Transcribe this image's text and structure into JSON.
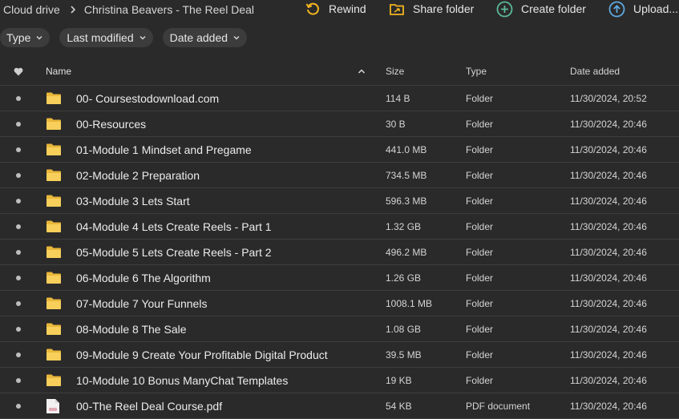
{
  "breadcrumb": [
    "Cloud drive",
    "Christina Beavers - The Reel Deal"
  ],
  "actions": {
    "rewind": "Rewind",
    "share_folder": "Share folder",
    "create_folder": "Create folder",
    "upload": "Upload..."
  },
  "filters": [
    "Type",
    "Last modified",
    "Date added"
  ],
  "columns": {
    "name": "Name",
    "size": "Size",
    "type": "Type",
    "date": "Date added"
  },
  "rows": [
    {
      "name": "00- Coursestodownload.com",
      "size": "114 B",
      "type": "Folder",
      "date": "11/30/2024, 20:52",
      "icon": "folder-icon"
    },
    {
      "name": "00-Resources",
      "size": "30 B",
      "type": "Folder",
      "date": "11/30/2024, 20:46",
      "icon": "folder-icon"
    },
    {
      "name": "01-Module 1 Mindset and Pregame",
      "size": "441.0 MB",
      "type": "Folder",
      "date": "11/30/2024, 20:46",
      "icon": "folder-icon"
    },
    {
      "name": "02-Module 2 Preparation",
      "size": "734.5 MB",
      "type": "Folder",
      "date": "11/30/2024, 20:46",
      "icon": "folder-icon"
    },
    {
      "name": "03-Module 3 Lets Start",
      "size": "596.3 MB",
      "type": "Folder",
      "date": "11/30/2024, 20:46",
      "icon": "folder-icon"
    },
    {
      "name": "04-Module 4 Lets Create Reels - Part 1",
      "size": "1.32 GB",
      "type": "Folder",
      "date": "11/30/2024, 20:46",
      "icon": "folder-icon"
    },
    {
      "name": "05-Module 5 Lets Create Reels - Part 2",
      "size": "496.2 MB",
      "type": "Folder",
      "date": "11/30/2024, 20:46",
      "icon": "folder-icon"
    },
    {
      "name": "06-Module 6 The Algorithm",
      "size": "1.26 GB",
      "type": "Folder",
      "date": "11/30/2024, 20:46",
      "icon": "folder-icon"
    },
    {
      "name": "07-Module 7 Your Funnels",
      "size": "1008.1 MB",
      "type": "Folder",
      "date": "11/30/2024, 20:46",
      "icon": "folder-icon"
    },
    {
      "name": "08-Module 8 The Sale",
      "size": "1.08 GB",
      "type": "Folder",
      "date": "11/30/2024, 20:46",
      "icon": "folder-icon"
    },
    {
      "name": "09-Module 9 Create Your Profitable Digital Product",
      "size": "39.5 MB",
      "type": "Folder",
      "date": "11/30/2024, 20:46",
      "icon": "folder-icon"
    },
    {
      "name": "10-Module 10 Bonus ManyChat Templates",
      "size": "19 KB",
      "type": "Folder",
      "date": "11/30/2024, 20:46",
      "icon": "folder-icon"
    },
    {
      "name": "00-The Reel Deal Course.pdf",
      "size": "54 KB",
      "type": "PDF document",
      "date": "11/30/2024, 20:46",
      "icon": "pdf-file-icon"
    }
  ]
}
